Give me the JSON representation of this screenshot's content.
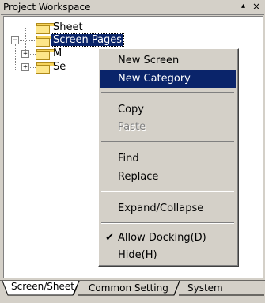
{
  "panel": {
    "title": "Project Workspace",
    "controls": {
      "pin": "▴",
      "close": "×"
    }
  },
  "tree": {
    "nodes": [
      {
        "label": "Sheet"
      },
      {
        "label": "Screen Pages"
      },
      {
        "label": "M"
      },
      {
        "label": "Se"
      }
    ]
  },
  "context_menu": {
    "items": [
      {
        "label": "New Screen"
      },
      {
        "label": "New Category"
      },
      {
        "label": "Copy"
      },
      {
        "label": "Paste"
      },
      {
        "label": "Find"
      },
      {
        "label": "Replace"
      },
      {
        "label": "Expand/Collapse"
      },
      {
        "label": "Allow Docking(D)",
        "checked": true
      },
      {
        "label": "Hide(H)"
      }
    ],
    "check_glyph": "✔"
  },
  "tabs": [
    {
      "label": "Screen/Sheet"
    },
    {
      "label": "Common Setting"
    },
    {
      "label": "System"
    }
  ],
  "colors": {
    "selection": "#0a246a",
    "folder": "#fde68a",
    "background": "#d4d0c8"
  }
}
